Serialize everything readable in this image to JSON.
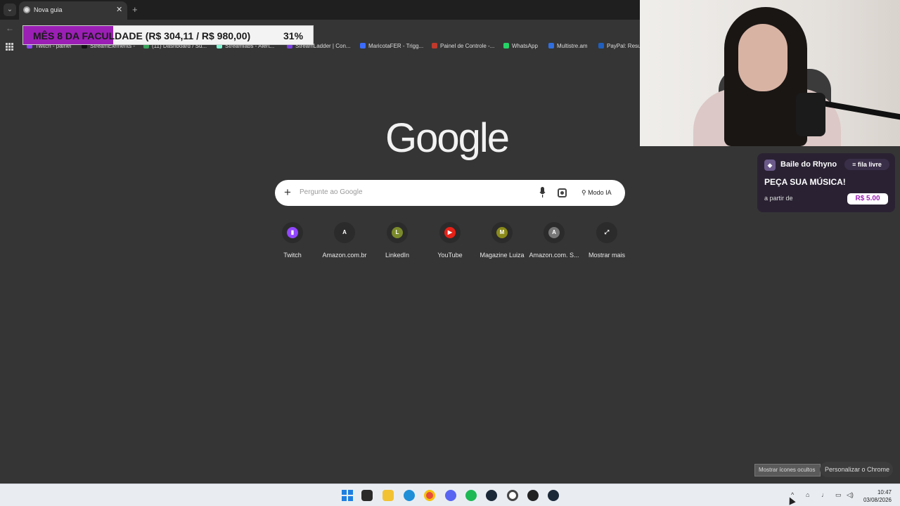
{
  "browser": {
    "tab_title": "Nova guia",
    "tab_close": "✕",
    "new_tab": "+",
    "back": "←",
    "bookmarks": [
      {
        "label": "Twitch - painel",
        "color": "#9146ff"
      },
      {
        "label": "StreamElements -",
        "color": "#111111"
      },
      {
        "label": "(11) Dashboard / Su...",
        "color": "#3ba55c"
      },
      {
        "label": "Streamlabs - Alert...",
        "color": "#80f5d2"
      },
      {
        "label": "StreamLadder | Con...",
        "color": "#7b3fe4"
      },
      {
        "label": "MaricotaFER - Trigg...",
        "color": "#3b6cff"
      },
      {
        "label": "Painel de Controle -...",
        "color": "#c0392b"
      },
      {
        "label": "WhatsApp",
        "color": "#25d366"
      },
      {
        "label": "Multistre.am",
        "color": "#2f6fe0"
      },
      {
        "label": "PayPal: Resum",
        "color": "#1f5fbf"
      }
    ]
  },
  "overlay_goal": {
    "text": "MÊS 8 DA FACULDADE (R$ 304,11 / R$ 980,00)",
    "percent_label": "31%",
    "progress": 0.31,
    "fill_color": "#9b1fb5"
  },
  "google": {
    "logo": "Google",
    "search_placeholder": "Pergunte ao Google",
    "plus_icon": "+",
    "ai_mode_label": "Modo IA",
    "ai_icon": "⚲",
    "shortcuts": [
      {
        "label": "Twitch",
        "glyph": "▮",
        "color": "#9146ff"
      },
      {
        "label": "Amazon.com.br",
        "glyph": "A",
        "color": "#2b2b2b"
      },
      {
        "label": "LinkedIn",
        "glyph": "L",
        "color": "#7a8a2a"
      },
      {
        "label": "YouTube",
        "glyph": "▶",
        "color": "#e62117"
      },
      {
        "label": "Magazine Luiza",
        "glyph": "M",
        "color": "#8a8a1a"
      },
      {
        "label": "Amazon.com. S...",
        "glyph": "A",
        "color": "#777777"
      },
      {
        "label": "Mostrar mais",
        "glyph": "⤢",
        "color": "#2b2b2b"
      }
    ],
    "customize_label": "Personalizar o Chrome"
  },
  "song_widget": {
    "name": "Baile do Rhyno",
    "tag": "≡ fila livre",
    "headline": "PEÇA SUA MÚSICA!",
    "from_label": "a partir de",
    "price": "R$ 5.00"
  },
  "taskbar": {
    "tooltip": "Mostrar ícones ocultos",
    "time": "10:47",
    "date": "03/08/2026",
    "tray_arrow": "^"
  }
}
